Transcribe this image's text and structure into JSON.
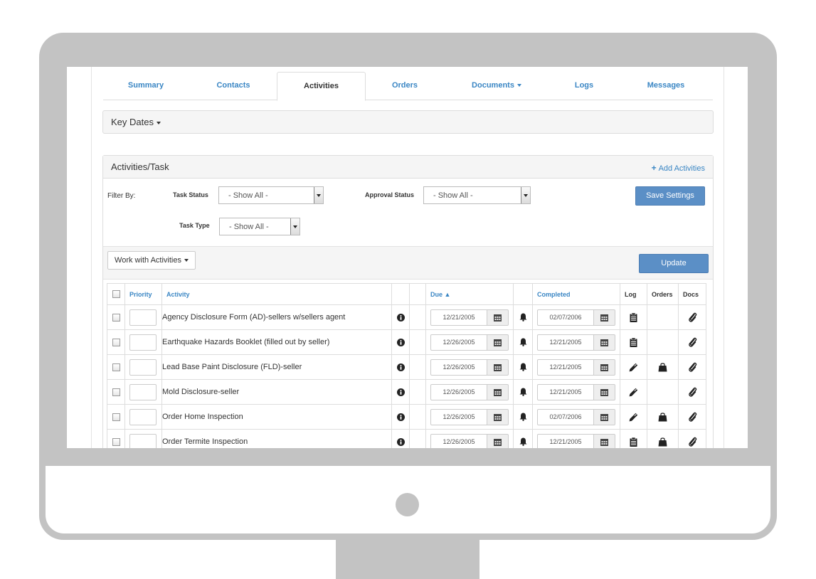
{
  "tabs": [
    {
      "label": "Summary"
    },
    {
      "label": "Contacts"
    },
    {
      "label": "Activities"
    },
    {
      "label": "Orders"
    },
    {
      "label": "Documents"
    },
    {
      "label": "Logs"
    },
    {
      "label": "Messages"
    }
  ],
  "key_dates": {
    "title": "Key Dates"
  },
  "panel": {
    "title": "Activities/Task",
    "add_label": "Add Activities",
    "filter_label": "Filter By:",
    "task_status_label": "Task Status",
    "task_status_value": "- Show All -",
    "approval_status_label": "Approval Status",
    "approval_status_value": "- Show All -",
    "task_type_label": "Task Type",
    "task_type_value": "- Show All -",
    "save_settings": "Save Settings",
    "work_with": "Work with Activities",
    "update": "Update"
  },
  "table": {
    "headers": {
      "priority": "Priority",
      "activity": "Activity",
      "due": "Due",
      "completed": "Completed",
      "log": "Log",
      "orders": "Orders",
      "docs": "Docs"
    },
    "rows": [
      {
        "activity": "Agency Disclosure Form (AD)-sellers w/sellers agent",
        "due": "12/21/2005",
        "completed": "02/07/2006",
        "log": "clipboard-icon",
        "orders": ""
      },
      {
        "activity": "Earthquake Hazards Booklet (filled out by seller)",
        "due": "12/26/2005",
        "completed": "12/21/2005",
        "log": "clipboard-icon",
        "orders": ""
      },
      {
        "activity": "Lead Base Paint Disclosure (FLD)-seller",
        "due": "12/26/2005",
        "completed": "12/21/2005",
        "log": "pencil-icon",
        "orders": "shopping-bag-icon"
      },
      {
        "activity": "Mold Disclosure-seller",
        "due": "12/26/2005",
        "completed": "12/21/2005",
        "log": "pencil-icon",
        "orders": ""
      },
      {
        "activity": "Order Home Inspection",
        "due": "12/26/2005",
        "completed": "02/07/2006",
        "log": "pencil-icon",
        "orders": "shopping-bag-icon"
      },
      {
        "activity": "Order Termite Inspection",
        "due": "12/26/2005",
        "completed": "12/21/2005",
        "log": "clipboard-icon",
        "orders": "shopping-bag-icon"
      }
    ]
  },
  "colors": {
    "link": "#3a86c4",
    "primary": "#5b8fc6",
    "frame": "#c3c3c3"
  }
}
